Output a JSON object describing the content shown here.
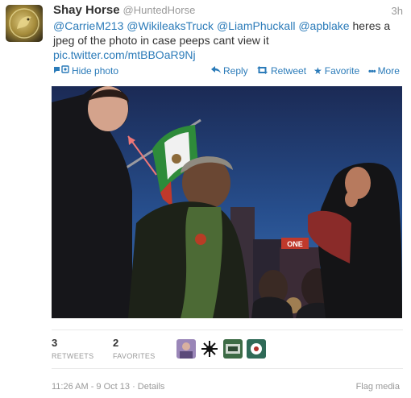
{
  "tweet": {
    "fullname": "Shay Horse",
    "username": "@HuntedHorse",
    "time": "3h",
    "text_parts": {
      "mention_1": "@CarrieM213",
      "mention_2": "@WikileaksTruck",
      "mention_3": "@LiamPhuckall",
      "mention_4": "@apblake",
      "text": " heres a jpeg of the photo in case peeps cant view it",
      "link": "pic.twitter.com/mtBBOaR9Nj"
    }
  },
  "actions": {
    "hide_photo": "Hide photo",
    "reply": "Reply",
    "retweet": "Retweet",
    "favorite": "Favorite",
    "more": "More"
  },
  "photo": {
    "sign_text": "ONE"
  },
  "stats": {
    "retweets_count": "3",
    "retweets_label": "RETWEETS",
    "favorites_count": "2",
    "favorites_label": "FAVORITES"
  },
  "footer": {
    "timestamp": "11:26 AM - 9 Oct 13",
    "separator": " · ",
    "details": "Details",
    "flag_media": "Flag media"
  },
  "colors": {
    "link": "#2b7bb9",
    "muted": "#999999",
    "text": "#333333"
  },
  "icons": {
    "hide_photo": "photo-icon",
    "reply": "reply-icon",
    "retweet": "retweet-icon",
    "favorite": "star-icon",
    "more": "ellipsis-icon"
  }
}
